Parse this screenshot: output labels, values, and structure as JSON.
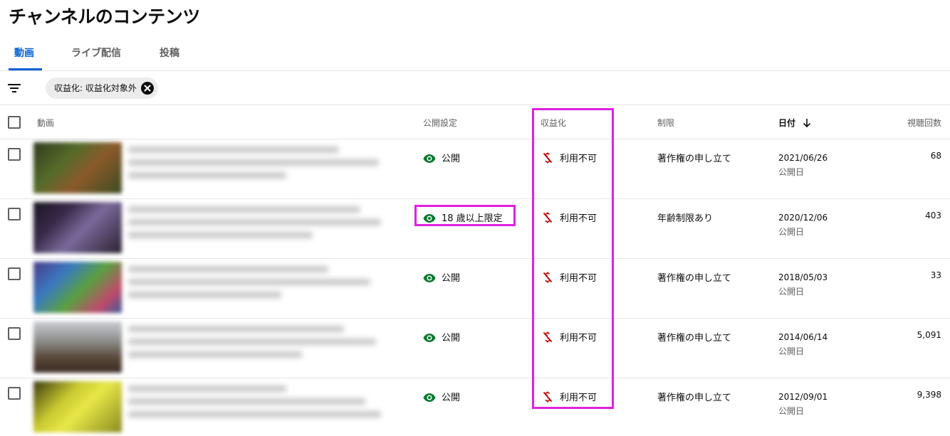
{
  "page": {
    "title": "チャンネルのコンテンツ"
  },
  "tabs": [
    {
      "label": "動画",
      "active": true
    },
    {
      "label": "ライブ配信",
      "active": false
    },
    {
      "label": "投稿",
      "active": false
    }
  ],
  "filter": {
    "chip_label": "収益化: 収益化対象外"
  },
  "columns": {
    "video": "動画",
    "visibility": "公開設定",
    "monetization": "収益化",
    "restrictions": "制限",
    "date": "日付",
    "views": "視聴回数"
  },
  "rows": [
    {
      "visibility": "公開",
      "monetization": "利用不可",
      "restriction": "著作権の申し立て",
      "date": "2021/06/26",
      "date_sub": "公開日",
      "views": "68"
    },
    {
      "visibility": "18 歳以上限定",
      "monetization": "利用不可",
      "restriction": "年齢制限あり",
      "date": "2020/12/06",
      "date_sub": "公開日",
      "views": "403"
    },
    {
      "visibility": "公開",
      "monetization": "利用不可",
      "restriction": "著作権の申し立て",
      "date": "2018/05/03",
      "date_sub": "公開日",
      "views": "33"
    },
    {
      "visibility": "公開",
      "monetization": "利用不可",
      "restriction": "著作権の申し立て",
      "date": "2014/06/14",
      "date_sub": "公開日",
      "views": "5,091"
    },
    {
      "visibility": "公開",
      "monetization": "利用不可",
      "restriction": "著作権の申し立て",
      "date": "2012/09/01",
      "date_sub": "公開日",
      "views": "9,398"
    }
  ],
  "colors": {
    "accent": "#065fd4",
    "visibility_icon": "#0a7a32",
    "monetization_off": "#c00000",
    "highlight": "#e020e0"
  },
  "icons": {
    "filter": "filter-lines-icon",
    "chip_close": "close-circle-icon",
    "sort": "arrow-down-icon",
    "visibility": "eye-icon",
    "monetization": "dollar-off-icon"
  }
}
